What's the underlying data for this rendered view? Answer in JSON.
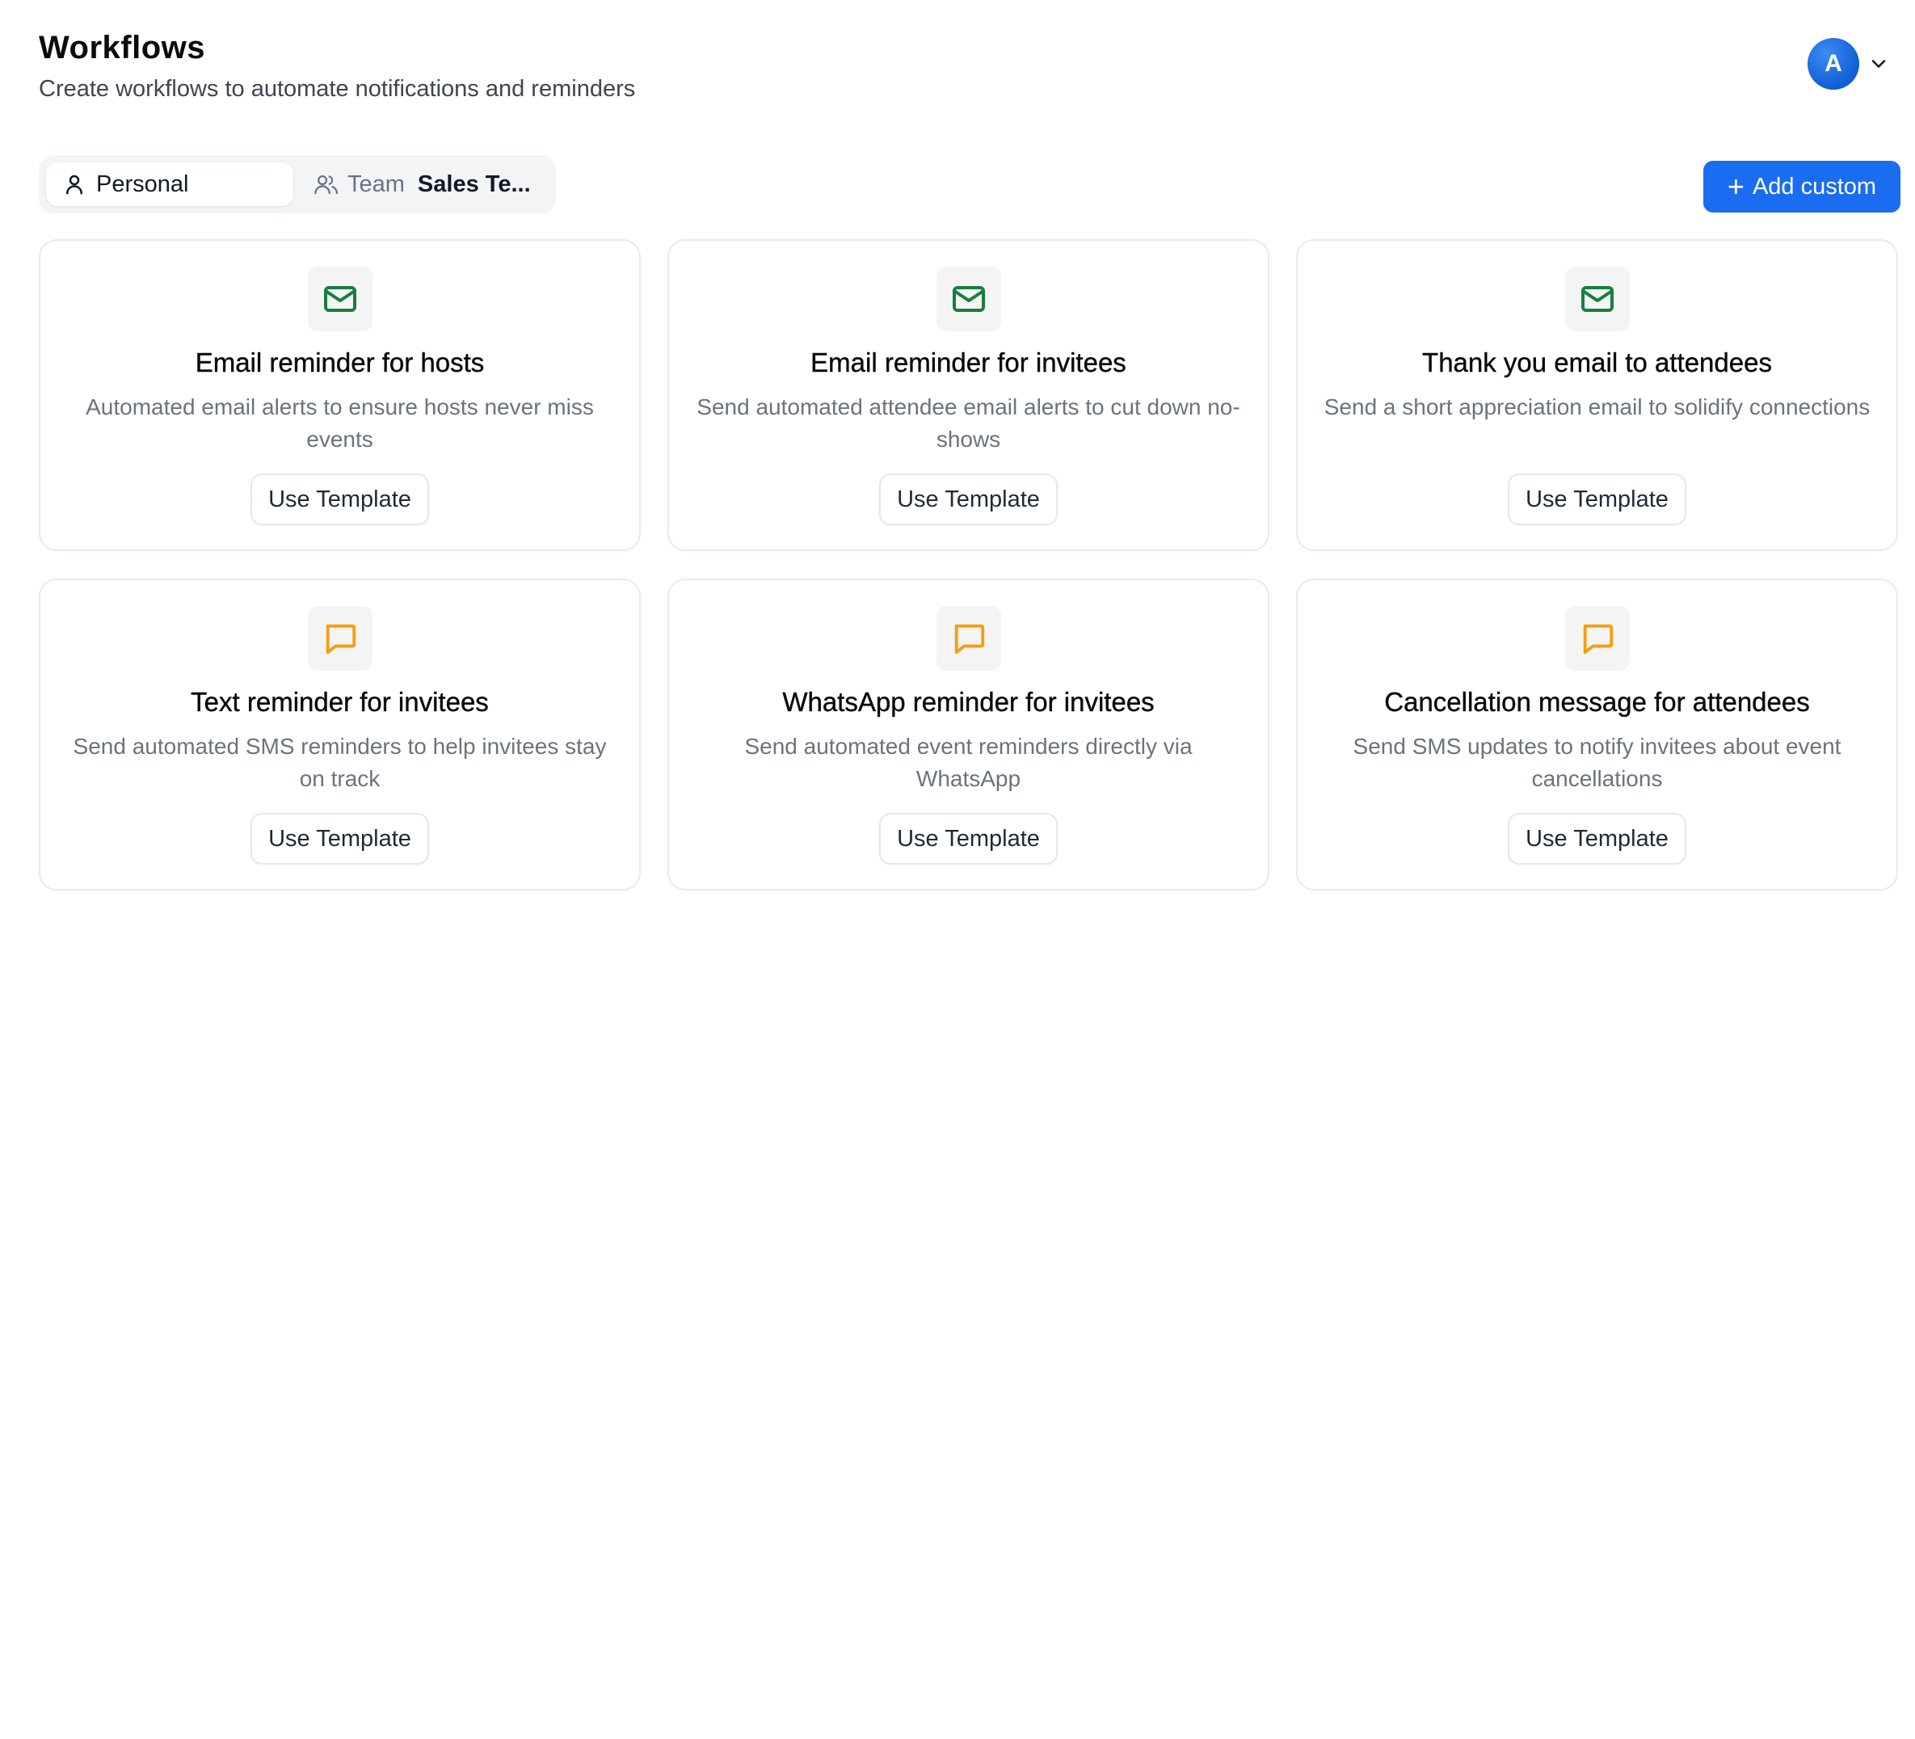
{
  "header": {
    "title": "Workflows",
    "subtitle": "Create workflows to automate notifications and reminders"
  },
  "user": {
    "avatar_initial": "A",
    "menu_icon": "chevron-down-icon"
  },
  "tabs": {
    "personal_label": "Personal",
    "personal_icon": "user-icon",
    "team_label": "Team",
    "team_icon": "users-icon",
    "team_name": "Sales Te..."
  },
  "actions": {
    "add_custom_label": "Add custom",
    "add_custom_icon": "plus-icon"
  },
  "colors": {
    "accent": "#1a6df0",
    "email_icon": "#15803d",
    "message_icon": "#f59e0b"
  },
  "templates": [
    {
      "icon": "mail-icon",
      "title": "Email reminder for hosts",
      "description": "Automated email alerts to ensure hosts never miss events",
      "button_label": "Use Template"
    },
    {
      "icon": "mail-icon",
      "title": "Email reminder for invitees",
      "description": "Send automated attendee email alerts to cut down no-shows",
      "button_label": "Use Template"
    },
    {
      "icon": "mail-icon",
      "title": "Thank you email to attendees",
      "description": "Send a short appreciation email to solidify connections",
      "button_label": "Use Template"
    },
    {
      "icon": "message-square-icon",
      "title": "Text reminder for invitees",
      "description": "Send automated SMS reminders to help invitees stay on track",
      "button_label": "Use Template"
    },
    {
      "icon": "message-square-icon",
      "title": "WhatsApp reminder for invitees",
      "description": "Send automated event reminders directly via WhatsApp",
      "button_label": "Use Template"
    },
    {
      "icon": "message-square-icon",
      "title": "Cancellation message for attendees",
      "description": "Send SMS updates to notify invitees about event cancellations",
      "button_label": "Use Template"
    }
  ]
}
